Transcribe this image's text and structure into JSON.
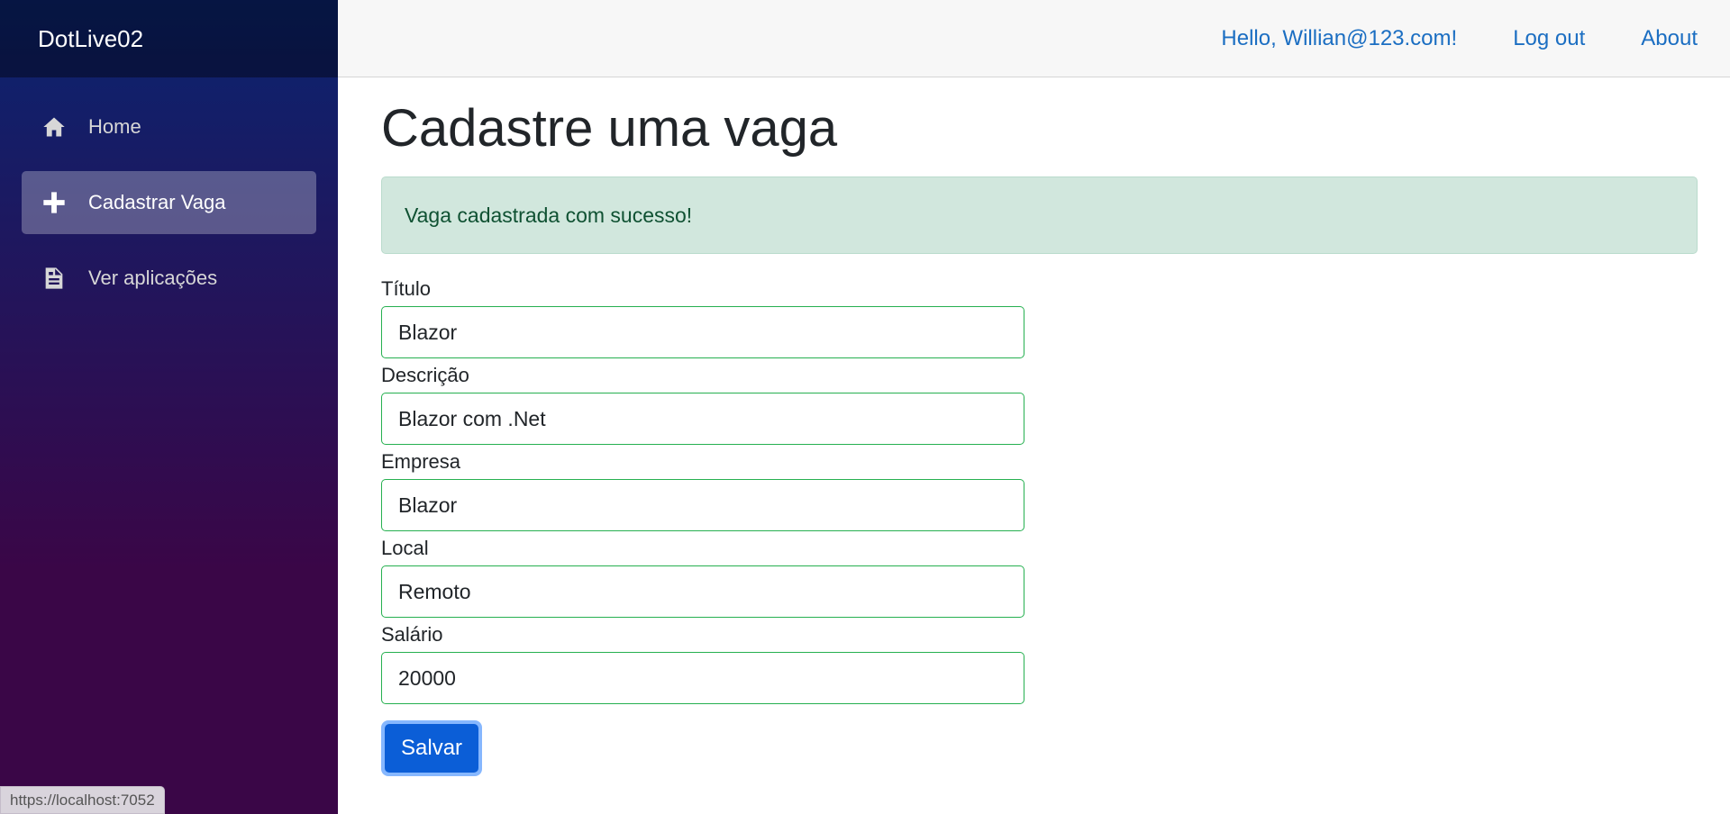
{
  "app": {
    "brand": "DotLive02"
  },
  "sidebar": {
    "items": [
      {
        "label": "Home",
        "icon": "home-icon",
        "active": false
      },
      {
        "label": "Cadastrar Vaga",
        "icon": "plus-icon",
        "active": true
      },
      {
        "label": "Ver aplicações",
        "icon": "document-list-icon",
        "active": false
      }
    ]
  },
  "topbar": {
    "greeting": "Hello, Willian@123.com!",
    "logout": "Log out",
    "about": "About"
  },
  "main": {
    "title": "Cadastre uma vaga",
    "alert": "Vaga cadastrada com sucesso!",
    "fields": [
      {
        "label": "Título",
        "value": "Blazor"
      },
      {
        "label": "Descrição",
        "value": "Blazor com .Net"
      },
      {
        "label": "Empresa",
        "value": "Blazor"
      },
      {
        "label": "Local",
        "value": "Remoto"
      },
      {
        "label": "Salário",
        "value": "20000"
      }
    ],
    "submit_label": "Salvar"
  },
  "status": {
    "url": "https://localhost:7052"
  },
  "colors": {
    "accent": "#1b6ec2",
    "button": "#0b5ed7",
    "alert_bg": "#d1e7dd",
    "valid_border": "#26b050"
  }
}
